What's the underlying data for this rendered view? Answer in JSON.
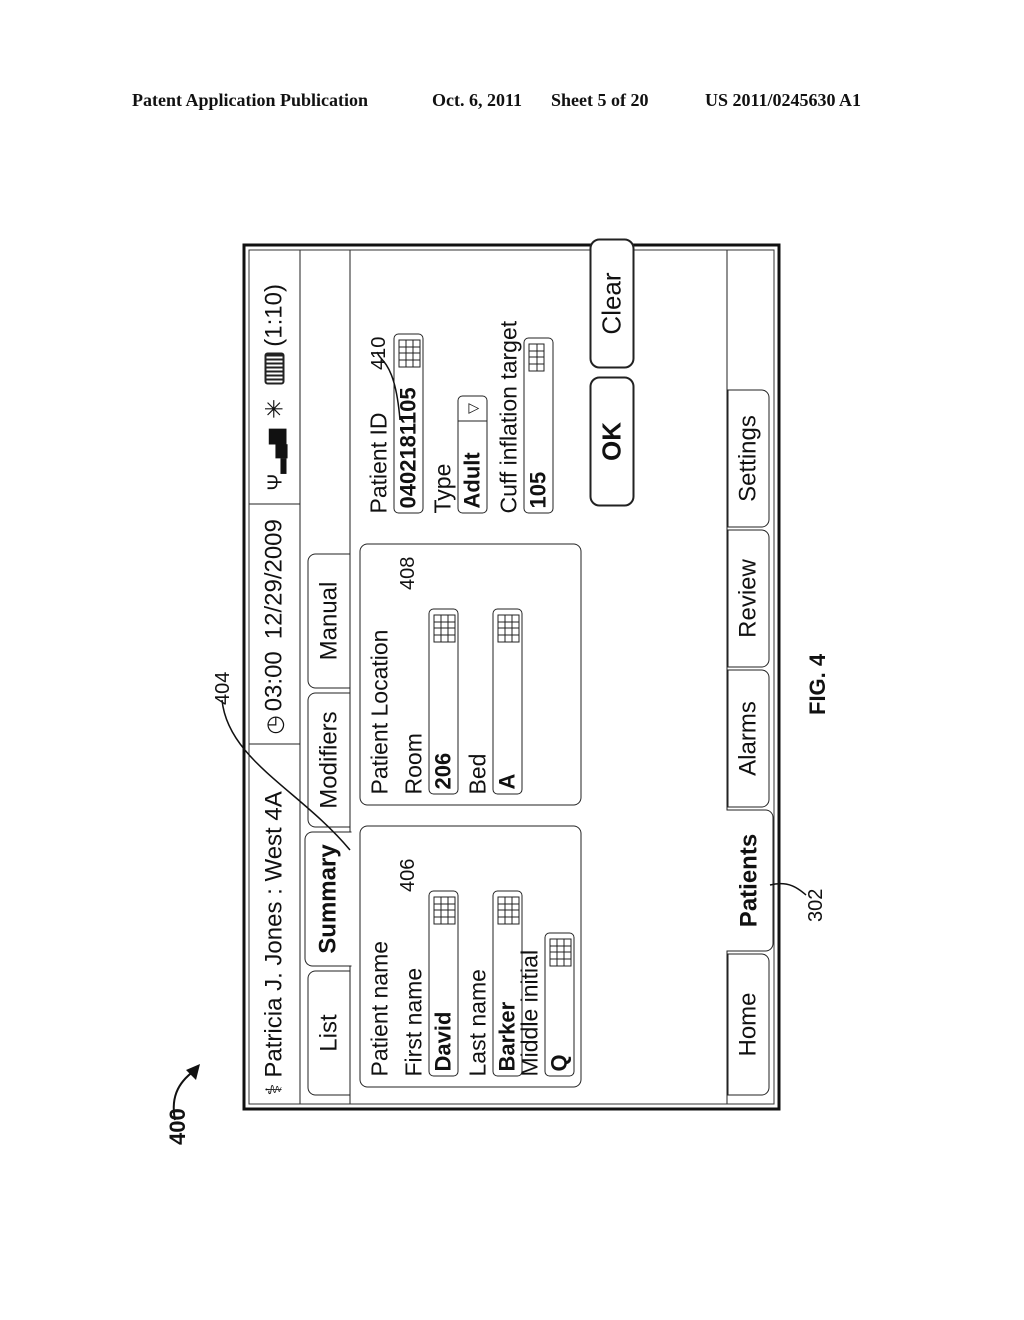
{
  "patent_header": {
    "left": "Patent Application Publication",
    "date": "Oct. 6, 2011",
    "sheet": "Sheet 5 of 20",
    "number": "US 2011/0245630 A1"
  },
  "figure": {
    "label": "FIG. 4",
    "ref_device": "400",
    "ref_summary_tab": "404",
    "ref_patient_name": "406",
    "ref_patient_location": "408",
    "ref_patient_id": "410",
    "ref_patients_tab": "302"
  },
  "status_bar": {
    "user_location": "Patricia J. Jones : West 4A",
    "time": "03:00",
    "date": "12/29/2009",
    "battery_time": "(1:10)",
    "icons": [
      "caduceus-icon",
      "clock-icon",
      "signal-icon",
      "connectivity-icon",
      "battery-icon"
    ]
  },
  "top_tabs": [
    {
      "label": "List",
      "active": false
    },
    {
      "label": "Summary",
      "active": true
    },
    {
      "label": "Modifiers",
      "active": false
    },
    {
      "label": "Manual",
      "active": false
    }
  ],
  "patient_name": {
    "title": "Patient name",
    "first_name_label": "First name",
    "first_name_value": "David",
    "last_name_label": "Last name",
    "last_name_value": "Barker",
    "middle_initial_label": "Middle initial",
    "middle_initial_value": "Q"
  },
  "patient_location": {
    "title": "Patient Location",
    "room_label": "Room",
    "room_value": "206",
    "bed_label": "Bed",
    "bed_value": "A"
  },
  "patient_info": {
    "id_label": "Patient ID",
    "id_value": "0402181105",
    "type_label": "Type",
    "type_value": "Adult",
    "cuff_label": "Cuff inflation target",
    "cuff_value": "105"
  },
  "buttons": {
    "ok": "OK",
    "clear": "Clear"
  },
  "bottom_tabs": [
    {
      "label": "Home",
      "active": false
    },
    {
      "label": "Patients",
      "active": true
    },
    {
      "label": "Alarms",
      "active": false
    },
    {
      "label": "Review",
      "active": false
    },
    {
      "label": "Settings",
      "active": false
    }
  ]
}
